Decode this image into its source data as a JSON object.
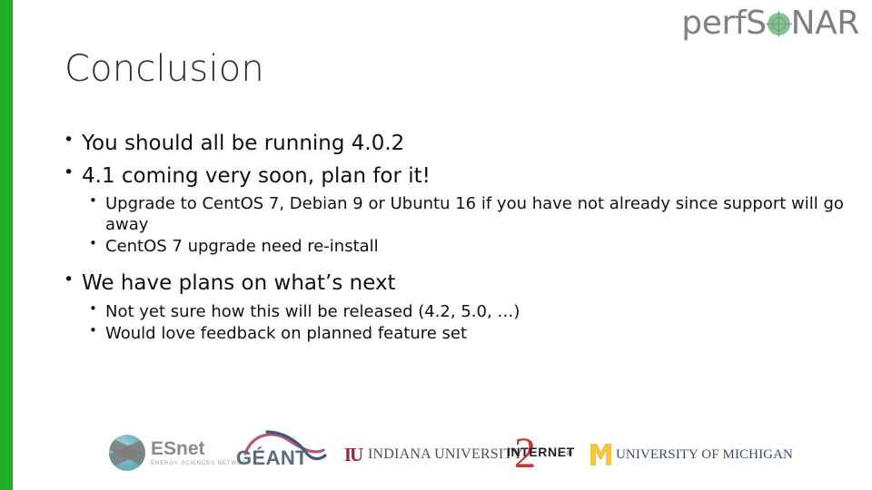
{
  "brand": {
    "logo_text_left": "perfS",
    "logo_text_right": "NAR",
    "logo_mark": "globe-crosshair-icon",
    "accent_color": "#22b022",
    "logo_color": "#808080",
    "logo_mark_color": "#86c194"
  },
  "title": "Conclusion",
  "bullets": [
    {
      "text": "You should all be running 4.0.2",
      "children": []
    },
    {
      "text": "4.1 coming very soon, plan for it!",
      "children": [
        "Upgrade to CentOS 7, Debian 9 or Ubuntu 16 if you have not already since support will go away",
        "CentOS 7 upgrade need re-install"
      ]
    },
    {
      "text": "We have plans on what’s next",
      "children": [
        "Not yet sure how this will be released (4.2, 5.0, …)",
        "Would love feedback on planned feature set"
      ]
    }
  ],
  "footer_logos": [
    {
      "id": "esnet",
      "name": "ESnet",
      "tagline": "ENERGY SCIENCES NETWORK",
      "color": "#8a8a8a"
    },
    {
      "id": "geant",
      "name": "GÉANT",
      "color": "#5a6b80"
    },
    {
      "id": "indiana-university",
      "mark": "IU",
      "name": "INDIANA UNIVERSITY",
      "color": "#9f2638"
    },
    {
      "id": "internet2",
      "name": "INTERNET",
      "numeral": "2",
      "registered": "®",
      "color": "#c8343c"
    },
    {
      "id": "university-of-michigan",
      "mark": "M",
      "name": "UNIVERSITY OF MICHIGAN",
      "color": "#3c4a6b"
    }
  ]
}
